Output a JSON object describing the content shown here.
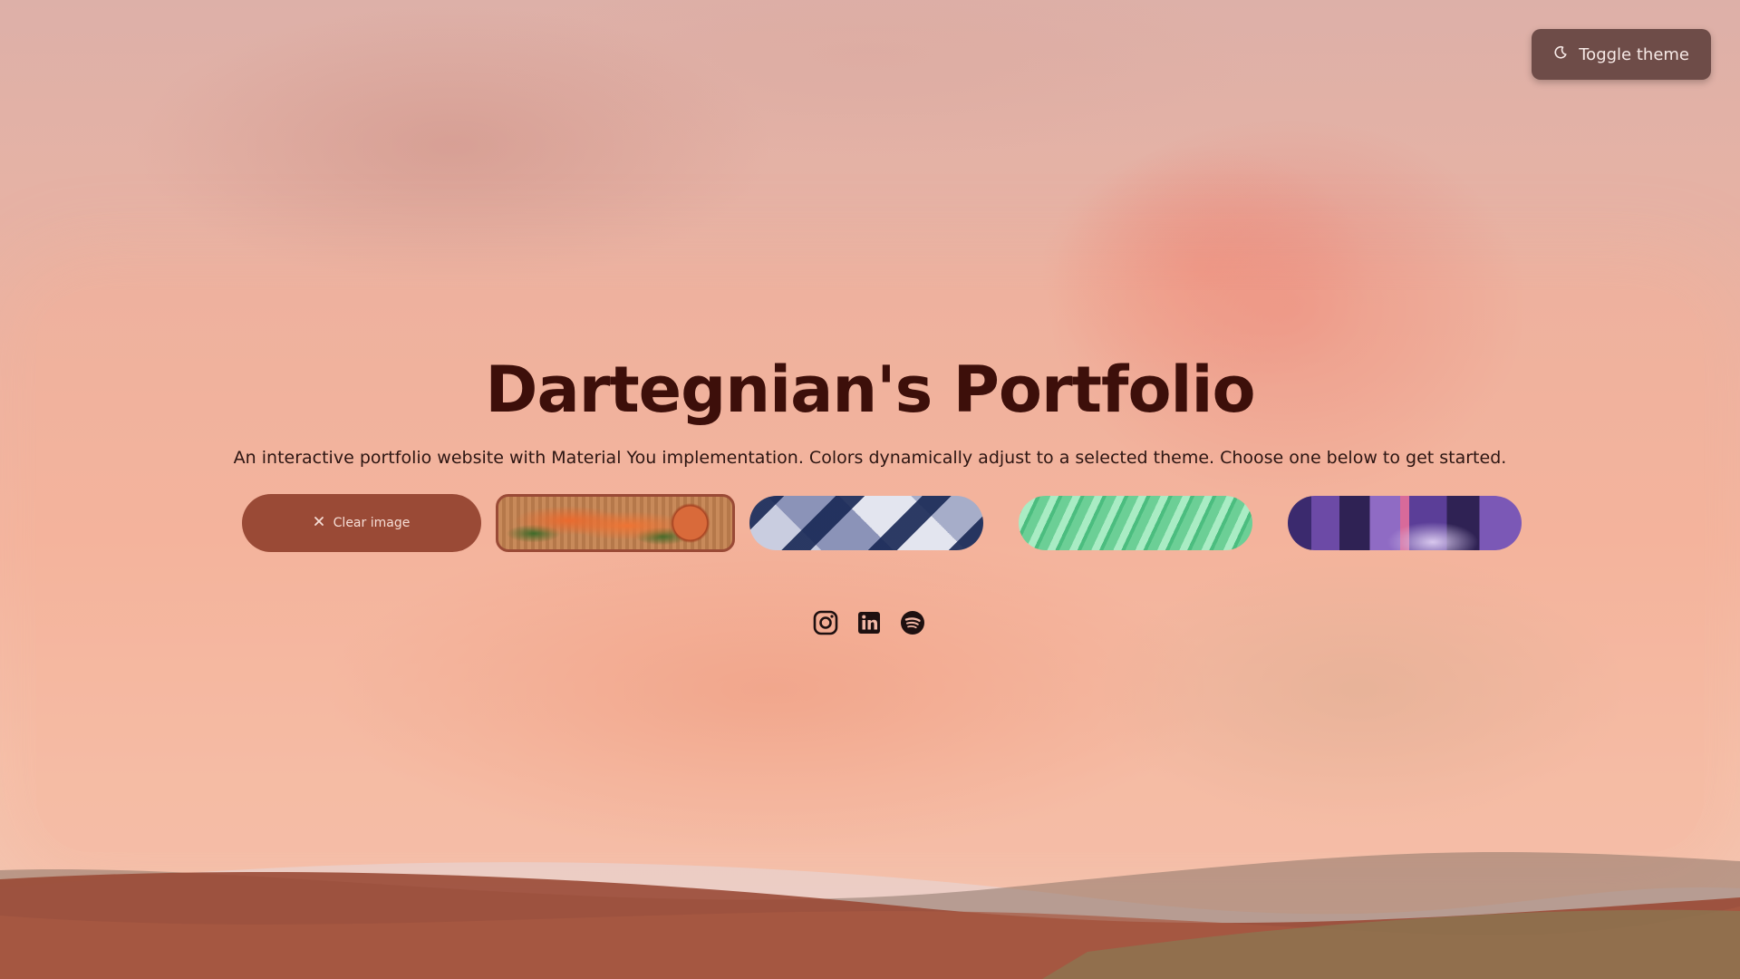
{
  "header": {
    "theme_button_label": "Toggle theme",
    "theme_icon": "moon-icon"
  },
  "hero": {
    "title": "Dartegnian's Portfolio",
    "subtitle": "An interactive portfolio website with Material You implementation. Colors dynamically adjust to a selected theme. Choose one below to get started."
  },
  "theme_picker": {
    "clear_label": "Clear image",
    "clear_icon": "close-icon",
    "images": [
      {
        "name": "salmon-food-image",
        "selected": true
      },
      {
        "name": "blue-geometric-image",
        "selected": false
      },
      {
        "name": "green-waves-image",
        "selected": false
      },
      {
        "name": "purple-room-image",
        "selected": false
      }
    ]
  },
  "socials": [
    "instagram-icon",
    "linkedin-icon",
    "spotify-icon"
  ],
  "colors": {
    "primary": "#9a4a36",
    "on_surface": "#3d0f0a",
    "theme_button_bg": "#6e4c48",
    "background": "#f2b8a6"
  }
}
